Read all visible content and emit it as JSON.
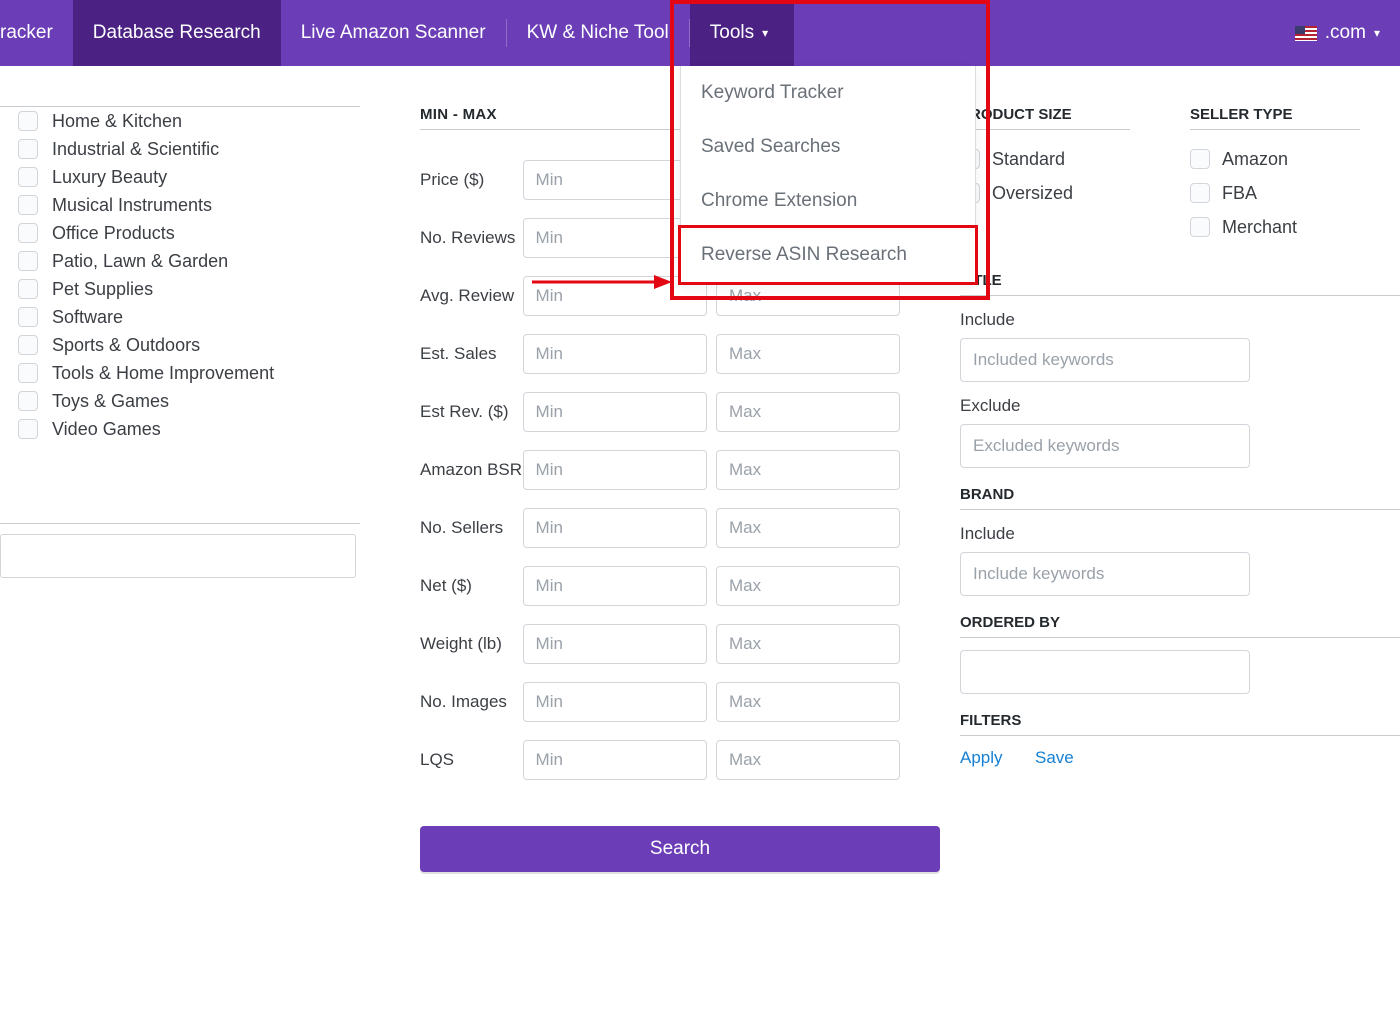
{
  "nav": {
    "items": [
      {
        "label": "racker"
      },
      {
        "label": "Database Research"
      },
      {
        "label": "Live Amazon Scanner"
      },
      {
        "label": "KW & Niche Tool"
      },
      {
        "label": "Tools"
      }
    ],
    "locale_domain": ".com"
  },
  "tools_dropdown": [
    "Keyword Tracker",
    "Saved Searches",
    "Chrome Extension",
    "Reverse ASIN Research"
  ],
  "categories": [
    "Home & Kitchen",
    "Industrial & Scientific",
    "Luxury Beauty",
    "Musical Instruments",
    "Office Products",
    "Patio, Lawn & Garden",
    "Pet Supplies",
    "Software",
    "Sports & Outdoors",
    "Tools & Home Improvement",
    "Toys & Games",
    "Video Games"
  ],
  "minmax": {
    "heading": "MIN - MAX",
    "rows": [
      {
        "label": "Price ($)"
      },
      {
        "label": "No. Reviews"
      },
      {
        "label": "Avg. Review"
      },
      {
        "label": "Est. Sales"
      },
      {
        "label": "Est Rev. ($)"
      },
      {
        "label": "Amazon BSR"
      },
      {
        "label": "No. Sellers"
      },
      {
        "label": "Net ($)"
      },
      {
        "label": "Weight (lb)"
      },
      {
        "label": "No. Images"
      },
      {
        "label": "LQS"
      }
    ],
    "min_placeholder": "Min",
    "max_placeholder": "Max",
    "search_label": "Search"
  },
  "product_size": {
    "heading": "PRODUCT SIZE",
    "options": [
      "Standard",
      "Oversized"
    ]
  },
  "seller_type": {
    "heading": "SELLER TYPE",
    "options": [
      "Amazon",
      "FBA",
      "Merchant"
    ]
  },
  "title_filter": {
    "heading": "TITLE",
    "include_label": "Include",
    "include_placeholder": "Included keywords",
    "exclude_label": "Exclude",
    "exclude_placeholder": "Excluded keywords"
  },
  "brand_filter": {
    "heading": "BRAND",
    "include_label": "Include",
    "include_placeholder": "Include keywords"
  },
  "ordered_by": {
    "heading": "ORDERED BY"
  },
  "filters": {
    "heading": "FILTERS",
    "apply": "Apply",
    "save": "Save"
  }
}
